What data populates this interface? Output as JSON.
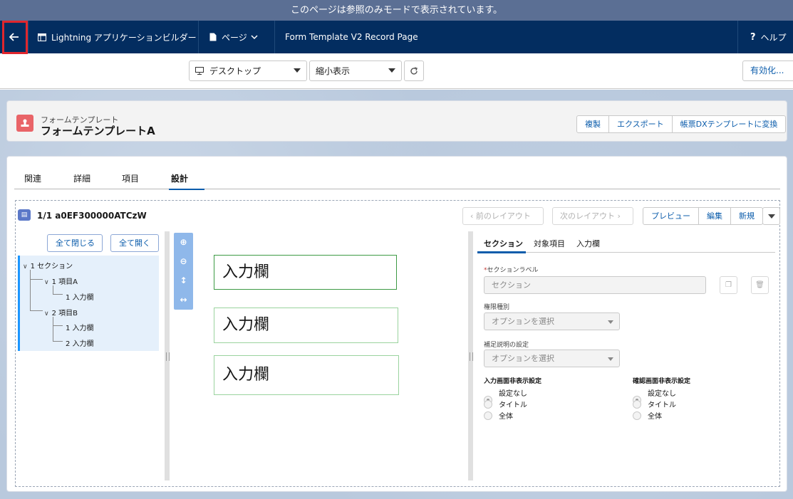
{
  "banner": {
    "text": "このページは参照のみモードで表示されています。"
  },
  "navbar": {
    "back_icon": "arrow-left-icon",
    "app_name": "Lightning アプリケーションビルダー",
    "page_menu": "ページ",
    "record_page_title": "Form Template V2 Record Page",
    "help": "ヘルプ"
  },
  "toolbar": {
    "device": "デスクトップ",
    "zoom": "縮小表示",
    "activate": "有効化..."
  },
  "record": {
    "object_label": "フォームテンプレート",
    "title": "フォームテンプレートA",
    "buttons": [
      "複製",
      "エクスポート",
      "帳票DXテンプレートに変換"
    ]
  },
  "tabs": [
    "関連",
    "詳細",
    "項目",
    "設計"
  ],
  "designer": {
    "title": "1/1 a0EF300000ATCzW",
    "prev": "前のレイアウト",
    "next": "次のレイアウト",
    "actions": [
      "プレビュー",
      "編集",
      "新規"
    ],
    "collapse_all": "全て閉じる",
    "expand_all": "全て開く",
    "tree": {
      "section": "1 セクション",
      "item_a": "1 項目A",
      "item_a_input": "1 入力欄",
      "item_b": "2 項目B",
      "item_b_input1": "1 入力欄",
      "item_b_input2": "2 入力欄"
    },
    "fields": [
      "入力欄",
      "入力欄",
      "入力欄"
    ]
  },
  "properties": {
    "tabs": [
      "セクション",
      "対象項目",
      "入力欄"
    ],
    "section_label_caption": "セクションラベル",
    "section_label_value": "セクション",
    "permission_caption": "権限種別",
    "permission_placeholder": "オプションを選択",
    "supplement_caption": "補足説明の設定",
    "supplement_placeholder": "オプションを選択",
    "input_hide_title": "入力画面非表示設定",
    "confirm_hide_title": "確認画面非表示設定",
    "hide_options": [
      "設定なし",
      "タイトル",
      "全体"
    ]
  }
}
